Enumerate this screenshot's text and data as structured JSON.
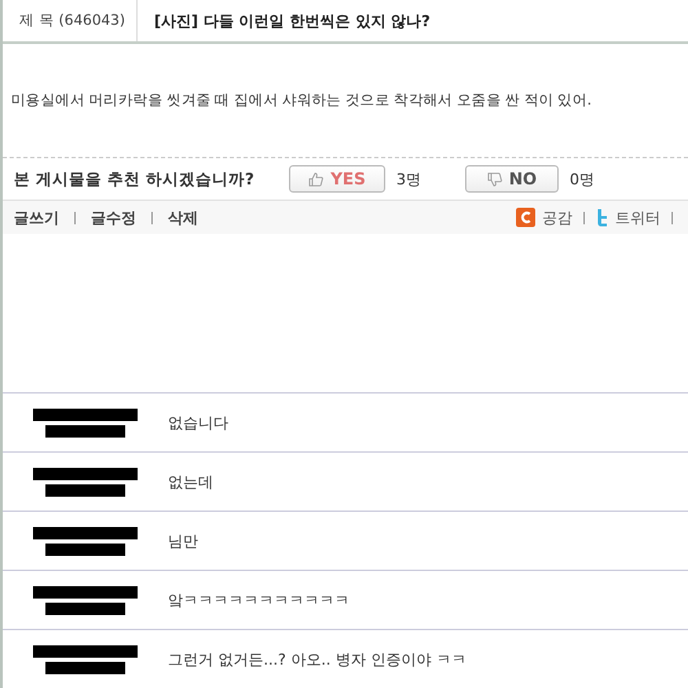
{
  "post": {
    "label": "제 목",
    "number": "(646043)",
    "title": "[사진] 다들 이런일 한번씩은 있지 않나?",
    "body": "미용실에서 머리카락을 씻겨줄 때 집에서 샤워하는 것으로 착각해서 오줌을 싼 적이 있어."
  },
  "recommend": {
    "question": "본 게시물을 추천 하시겠습니까?",
    "yes": {
      "label": "YES",
      "count": "3명"
    },
    "no": {
      "label": "NO",
      "count": "0명"
    }
  },
  "actions": [
    "글쓰기",
    "글수정",
    "삭제"
  ],
  "share": [
    {
      "kind": "c",
      "label": "공감"
    },
    {
      "kind": "t",
      "label": "트위터"
    }
  ],
  "comments": [
    {
      "text": "없습니다"
    },
    {
      "text": "없는데"
    },
    {
      "text": "님만"
    },
    {
      "text": "앜ㅋㅋㅋㅋㅋㅋㅋㅋㅋㅋㅋ"
    },
    {
      "text": "그런거 없거든...? 아오.. 병자 인증이야 ㅋㅋ"
    }
  ]
}
